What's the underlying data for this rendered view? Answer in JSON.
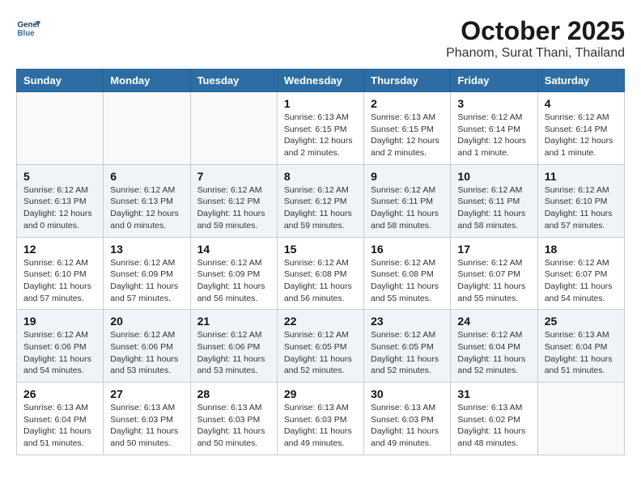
{
  "header": {
    "logo_line1": "General",
    "logo_line2": "Blue",
    "month": "October 2025",
    "location": "Phanom, Surat Thani, Thailand"
  },
  "weekdays": [
    "Sunday",
    "Monday",
    "Tuesday",
    "Wednesday",
    "Thursday",
    "Friday",
    "Saturday"
  ],
  "weeks": [
    [
      {
        "day": "",
        "info": ""
      },
      {
        "day": "",
        "info": ""
      },
      {
        "day": "",
        "info": ""
      },
      {
        "day": "1",
        "info": "Sunrise: 6:13 AM\nSunset: 6:15 PM\nDaylight: 12 hours\nand 2 minutes."
      },
      {
        "day": "2",
        "info": "Sunrise: 6:13 AM\nSunset: 6:15 PM\nDaylight: 12 hours\nand 2 minutes."
      },
      {
        "day": "3",
        "info": "Sunrise: 6:12 AM\nSunset: 6:14 PM\nDaylight: 12 hours\nand 1 minute."
      },
      {
        "day": "4",
        "info": "Sunrise: 6:12 AM\nSunset: 6:14 PM\nDaylight: 12 hours\nand 1 minute."
      }
    ],
    [
      {
        "day": "5",
        "info": "Sunrise: 6:12 AM\nSunset: 6:13 PM\nDaylight: 12 hours\nand 0 minutes."
      },
      {
        "day": "6",
        "info": "Sunrise: 6:12 AM\nSunset: 6:13 PM\nDaylight: 12 hours\nand 0 minutes."
      },
      {
        "day": "7",
        "info": "Sunrise: 6:12 AM\nSunset: 6:12 PM\nDaylight: 11 hours\nand 59 minutes."
      },
      {
        "day": "8",
        "info": "Sunrise: 6:12 AM\nSunset: 6:12 PM\nDaylight: 11 hours\nand 59 minutes."
      },
      {
        "day": "9",
        "info": "Sunrise: 6:12 AM\nSunset: 6:11 PM\nDaylight: 11 hours\nand 58 minutes."
      },
      {
        "day": "10",
        "info": "Sunrise: 6:12 AM\nSunset: 6:11 PM\nDaylight: 11 hours\nand 58 minutes."
      },
      {
        "day": "11",
        "info": "Sunrise: 6:12 AM\nSunset: 6:10 PM\nDaylight: 11 hours\nand 57 minutes."
      }
    ],
    [
      {
        "day": "12",
        "info": "Sunrise: 6:12 AM\nSunset: 6:10 PM\nDaylight: 11 hours\nand 57 minutes."
      },
      {
        "day": "13",
        "info": "Sunrise: 6:12 AM\nSunset: 6:09 PM\nDaylight: 11 hours\nand 57 minutes."
      },
      {
        "day": "14",
        "info": "Sunrise: 6:12 AM\nSunset: 6:09 PM\nDaylight: 11 hours\nand 56 minutes."
      },
      {
        "day": "15",
        "info": "Sunrise: 6:12 AM\nSunset: 6:08 PM\nDaylight: 11 hours\nand 56 minutes."
      },
      {
        "day": "16",
        "info": "Sunrise: 6:12 AM\nSunset: 6:08 PM\nDaylight: 11 hours\nand 55 minutes."
      },
      {
        "day": "17",
        "info": "Sunrise: 6:12 AM\nSunset: 6:07 PM\nDaylight: 11 hours\nand 55 minutes."
      },
      {
        "day": "18",
        "info": "Sunrise: 6:12 AM\nSunset: 6:07 PM\nDaylight: 11 hours\nand 54 minutes."
      }
    ],
    [
      {
        "day": "19",
        "info": "Sunrise: 6:12 AM\nSunset: 6:06 PM\nDaylight: 11 hours\nand 54 minutes."
      },
      {
        "day": "20",
        "info": "Sunrise: 6:12 AM\nSunset: 6:06 PM\nDaylight: 11 hours\nand 53 minutes."
      },
      {
        "day": "21",
        "info": "Sunrise: 6:12 AM\nSunset: 6:06 PM\nDaylight: 11 hours\nand 53 minutes."
      },
      {
        "day": "22",
        "info": "Sunrise: 6:12 AM\nSunset: 6:05 PM\nDaylight: 11 hours\nand 52 minutes."
      },
      {
        "day": "23",
        "info": "Sunrise: 6:12 AM\nSunset: 6:05 PM\nDaylight: 11 hours\nand 52 minutes."
      },
      {
        "day": "24",
        "info": "Sunrise: 6:12 AM\nSunset: 6:04 PM\nDaylight: 11 hours\nand 52 minutes."
      },
      {
        "day": "25",
        "info": "Sunrise: 6:13 AM\nSunset: 6:04 PM\nDaylight: 11 hours\nand 51 minutes."
      }
    ],
    [
      {
        "day": "26",
        "info": "Sunrise: 6:13 AM\nSunset: 6:04 PM\nDaylight: 11 hours\nand 51 minutes."
      },
      {
        "day": "27",
        "info": "Sunrise: 6:13 AM\nSunset: 6:03 PM\nDaylight: 11 hours\nand 50 minutes."
      },
      {
        "day": "28",
        "info": "Sunrise: 6:13 AM\nSunset: 6:03 PM\nDaylight: 11 hours\nand 50 minutes."
      },
      {
        "day": "29",
        "info": "Sunrise: 6:13 AM\nSunset: 6:03 PM\nDaylight: 11 hours\nand 49 minutes."
      },
      {
        "day": "30",
        "info": "Sunrise: 6:13 AM\nSunset: 6:03 PM\nDaylight: 11 hours\nand 49 minutes."
      },
      {
        "day": "31",
        "info": "Sunrise: 6:13 AM\nSunset: 6:02 PM\nDaylight: 11 hours\nand 48 minutes."
      },
      {
        "day": "",
        "info": ""
      }
    ]
  ]
}
